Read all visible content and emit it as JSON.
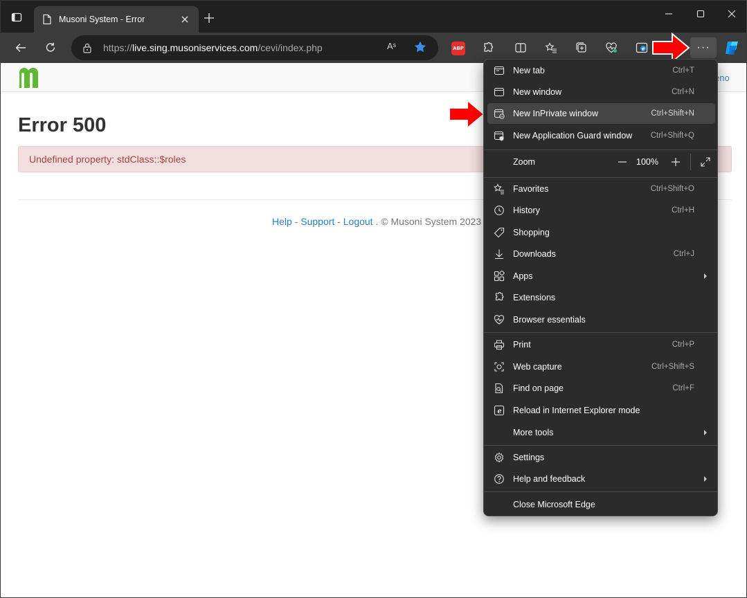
{
  "browser": {
    "tab_title": "Musoni System - Error",
    "url_prefix": "https://",
    "url_host": "live.sing.musoniservices.com",
    "url_path": "/cevi/index.php",
    "read_aloud_label": "Aˢ",
    "adblock_label": "ABP",
    "more_label": "···",
    "window_controls": [
      "—",
      "☐",
      "✕"
    ]
  },
  "page": {
    "header_link": "eno",
    "error_title": "Error 500",
    "alert_text": "Undefined property: stdClass::$roles",
    "footer": {
      "help": "Help",
      "sep1": " - ",
      "support": "Support",
      "sep2": " - ",
      "logout": "Logout",
      "suffix": " . © Musoni System 2023"
    }
  },
  "menu": {
    "items": [
      {
        "label": "New tab",
        "shortcut": "Ctrl+T",
        "icon": "new-tab-icon"
      },
      {
        "label": "New window",
        "shortcut": "Ctrl+N",
        "icon": "new-window-icon"
      },
      {
        "label": "New InPrivate window",
        "shortcut": "Ctrl+Shift+N",
        "icon": "inprivate-icon",
        "highlighted": true
      },
      {
        "label": "New Application Guard window",
        "shortcut": "Ctrl+Shift+Q",
        "icon": "app-guard-icon"
      },
      {
        "label": "Zoom",
        "zoom_value": "100%",
        "icon": ""
      },
      {
        "label": "Favorites",
        "shortcut": "Ctrl+Shift+O",
        "icon": "favorites-icon"
      },
      {
        "label": "History",
        "shortcut": "Ctrl+H",
        "icon": "history-icon"
      },
      {
        "label": "Shopping",
        "shortcut": "",
        "icon": "shopping-tag-icon"
      },
      {
        "label": "Downloads",
        "shortcut": "Ctrl+J",
        "icon": "download-icon"
      },
      {
        "label": "Apps",
        "shortcut": "",
        "icon": "apps-icon",
        "submenu": true
      },
      {
        "label": "Extensions",
        "shortcut": "",
        "icon": "extensions-icon"
      },
      {
        "label": "Browser essentials",
        "shortcut": "",
        "icon": "heart-pulse-icon"
      },
      {
        "label": "Print",
        "shortcut": "Ctrl+P",
        "icon": "print-icon"
      },
      {
        "label": "Web capture",
        "shortcut": "Ctrl+Shift+S",
        "icon": "web-capture-icon"
      },
      {
        "label": "Find on page",
        "shortcut": "Ctrl+F",
        "icon": "find-icon"
      },
      {
        "label": "Reload in Internet Explorer mode",
        "shortcut": "",
        "icon": "ie-mode-icon"
      },
      {
        "label": "More tools",
        "shortcut": "",
        "icon": "",
        "submenu": true
      },
      {
        "label": "Settings",
        "shortcut": "",
        "icon": "gear-icon"
      },
      {
        "label": "Help and feedback",
        "shortcut": "",
        "icon": "help-icon",
        "submenu": true
      },
      {
        "label": "Close Microsoft Edge",
        "shortcut": "",
        "icon": ""
      }
    ]
  },
  "colors": {
    "titlebar": "#202020",
    "toolbar": "#3b3b3b",
    "menu_bg": "#2b2b2b",
    "menu_highlight": "#454545",
    "logo_green": "#5fb832",
    "alert_bg": "#f2dede",
    "alert_text": "#a94442",
    "link": "#2a7fc0",
    "annotation_arrow": "#ff0000"
  }
}
